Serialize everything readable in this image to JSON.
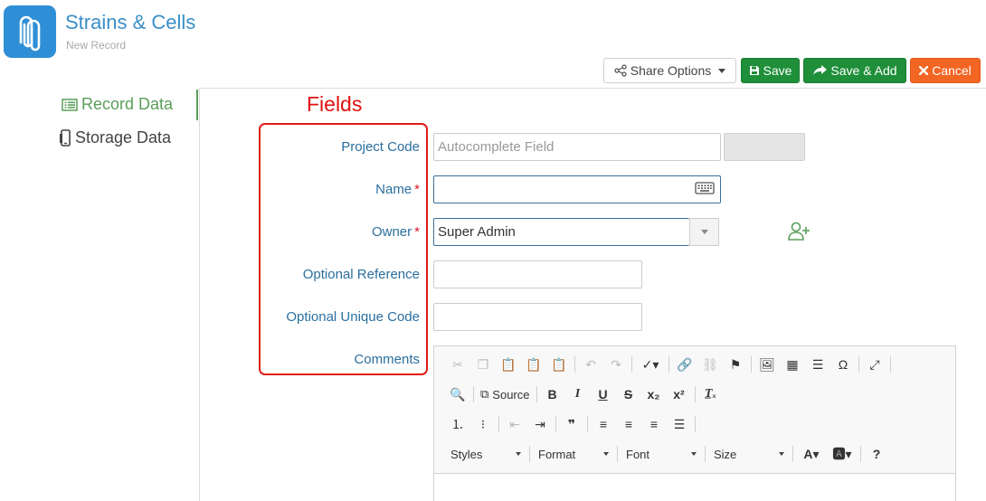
{
  "header": {
    "app_title": "Strains & Cells",
    "subtitle": "New Record",
    "logo_icon": "paperclip-icon",
    "logo_color": "#2f8fd6"
  },
  "toolbar": {
    "share_label": "Share Options",
    "save_label": "Save",
    "save_add_label": "Save & Add",
    "cancel_label": "Cancel",
    "save_color": "#1f8f3a",
    "cancel_color": "#f26522"
  },
  "nav": {
    "items": [
      {
        "label": "Record Data",
        "icon": "list-icon",
        "active": true
      },
      {
        "label": "Storage Data",
        "icon": "mobile-icon",
        "active": false
      }
    ]
  },
  "annotation": {
    "label": "Fields",
    "color": "#e01010"
  },
  "form": {
    "project_code": {
      "label": "Project Code",
      "placeholder": "Autocomplete Field",
      "value": ""
    },
    "name": {
      "label": "Name",
      "required_mark": "*",
      "value": ""
    },
    "owner": {
      "label": "Owner",
      "required_mark": "*",
      "value": "Super Admin"
    },
    "optional_reference": {
      "label": "Optional Reference",
      "value": ""
    },
    "optional_unique_code": {
      "label": "Optional Unique Code",
      "value": ""
    },
    "comments": {
      "label": "Comments"
    }
  },
  "editor": {
    "source_label": "Source",
    "styles_label": "Styles",
    "format_label": "Format",
    "font_label": "Font",
    "size_label": "Size",
    "bold": "B",
    "italic": "I",
    "underline": "U",
    "strike": "S",
    "help": "?",
    "omega": "Ω"
  }
}
